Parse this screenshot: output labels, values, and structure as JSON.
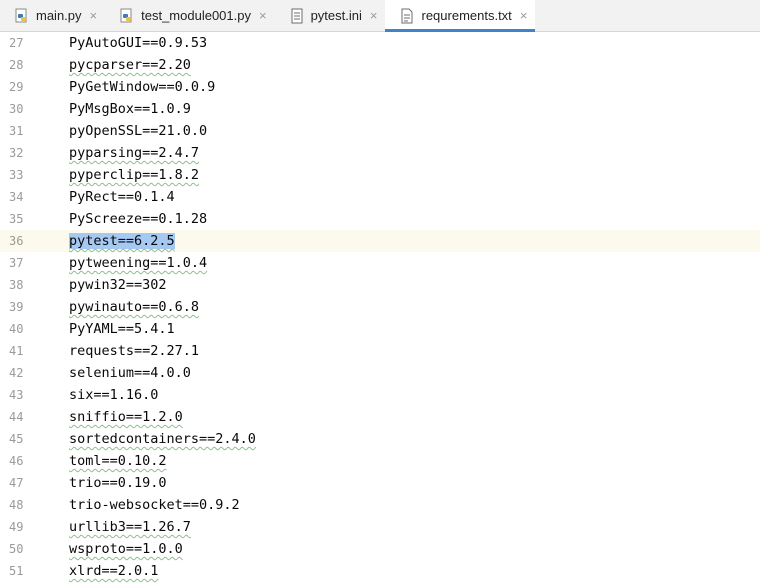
{
  "tabs": [
    {
      "label": "main.py",
      "icon": "python-file-icon",
      "active": false
    },
    {
      "label": "test_module001.py",
      "icon": "python-file-icon",
      "active": false
    },
    {
      "label": "pytest.ini",
      "icon": "ini-file-icon",
      "active": false
    },
    {
      "label": "requrements.txt",
      "icon": "text-file-icon",
      "active": true
    }
  ],
  "close_glyph": "×",
  "editor": {
    "current_line": 36,
    "lines": [
      {
        "n": "27",
        "text": "PyAutoGUI==0.9.53"
      },
      {
        "n": "28",
        "text": "pycparser==2.20"
      },
      {
        "n": "29",
        "text": "PyGetWindow==0.0.9"
      },
      {
        "n": "30",
        "text": "PyMsgBox==1.0.9"
      },
      {
        "n": "31",
        "text": "pyOpenSSL==21.0.0"
      },
      {
        "n": "32",
        "text": "pyparsing==2.4.7"
      },
      {
        "n": "33",
        "text": "pyperclip==1.8.2"
      },
      {
        "n": "34",
        "text": "PyRect==0.1.4"
      },
      {
        "n": "35",
        "text": "PyScreeze==0.1.28"
      },
      {
        "n": "36",
        "text": "pytest==6.2.5"
      },
      {
        "n": "37",
        "text": "pytweening==1.0.4"
      },
      {
        "n": "38",
        "text": "pywin32==302"
      },
      {
        "n": "39",
        "text": "pywinauto==0.6.8"
      },
      {
        "n": "40",
        "text": "PyYAML==5.4.1"
      },
      {
        "n": "41",
        "text": "requests==2.27.1"
      },
      {
        "n": "42",
        "text": "selenium==4.0.0"
      },
      {
        "n": "43",
        "text": "six==1.16.0"
      },
      {
        "n": "44",
        "text": "sniffio==1.2.0"
      },
      {
        "n": "45",
        "text": "sortedcontainers==2.4.0"
      },
      {
        "n": "46",
        "text": "toml==0.10.2"
      },
      {
        "n": "47",
        "text": "trio==0.19.0"
      },
      {
        "n": "48",
        "text": "trio-websocket==0.9.2"
      },
      {
        "n": "49",
        "text": "urllib3==1.26.7"
      },
      {
        "n": "50",
        "text": "wsproto==1.0.0"
      },
      {
        "n": "51",
        "text": "xlrd==2.0.1"
      }
    ]
  },
  "colors": {
    "selection": "#a6c9f4",
    "current_line": "#fcfaed",
    "active_tab_underline": "#4083c9",
    "line_number": "#9a9a9a"
  }
}
